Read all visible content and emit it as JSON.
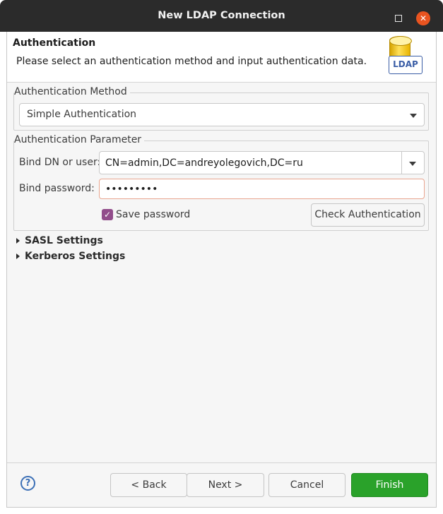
{
  "window": {
    "title": "New LDAP Connection"
  },
  "header": {
    "title": "Authentication",
    "description": "Please select an authentication method and input authentication data.",
    "icon_label": "LDAP"
  },
  "auth_method": {
    "group_label": "Authentication Method",
    "selected": "Simple Authentication"
  },
  "auth_params": {
    "group_label": "Authentication Parameter",
    "bind_dn_label": "Bind DN or user:",
    "bind_dn_value": "CN=admin,DC=andreyolegovich,DC=ru",
    "password_label": "Bind password:",
    "password_value": "•••••••••",
    "save_password_label": "Save password",
    "save_password_checked": true,
    "check_button": "Check Authentication"
  },
  "sections": {
    "sasl": "SASL Settings",
    "kerberos": "Kerberos Settings"
  },
  "buttons": {
    "back": "< Back",
    "next": "Next >",
    "cancel": "Cancel",
    "finish": "Finish"
  },
  "colors": {
    "finish_bg": "#2aa22a",
    "checkbox": "#924d8b",
    "close_button": "#e95420",
    "focus_border": "#e9a58f"
  }
}
